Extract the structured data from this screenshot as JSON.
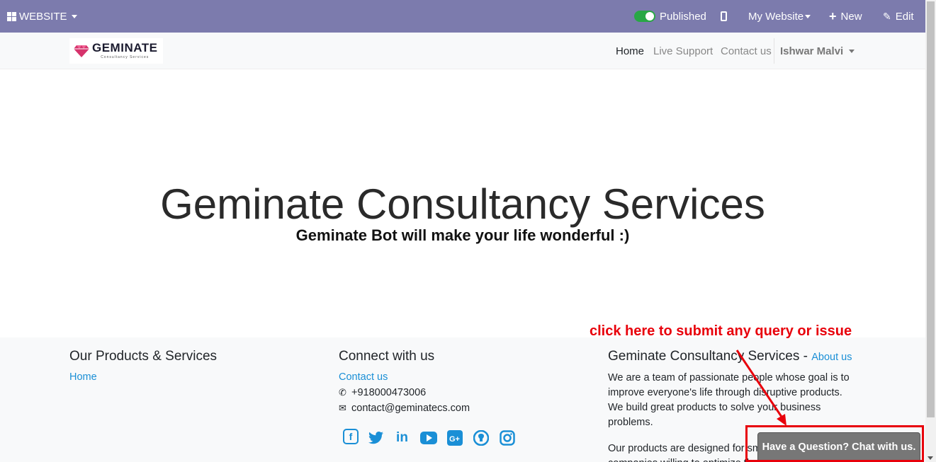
{
  "adminbar": {
    "website_label": "WEBSITE",
    "published_label": "Published",
    "my_website_label": "My Website",
    "new_label": "New",
    "edit_label": "Edit",
    "bg_color": "#7c7bad"
  },
  "navbar": {
    "logo_text": "GEMINATE",
    "logo_sub": "Consultancy Services",
    "links": [
      "Home",
      "Live Support",
      "Contact us"
    ],
    "user": "Ishwar Malvi"
  },
  "hero": {
    "title": "Geminate Consultancy Services",
    "subtitle": "Geminate Bot will make your life wonderful :)"
  },
  "footer": {
    "col1": {
      "title": "Our Products & Services",
      "link": "Home"
    },
    "col2": {
      "title": "Connect with us",
      "contact_link": "Contact us",
      "phone": "+918000473006",
      "email": "contact@geminatecs.com",
      "social": [
        "facebook-icon",
        "twitter-icon",
        "linkedin-icon",
        "youtube-icon",
        "google-plus-icon",
        "github-icon",
        "instagram-icon"
      ]
    },
    "col3": {
      "title": "Geminate Consultancy Services",
      "separator": " - ",
      "about_link": "About us",
      "p1": "We are a team of passionate people whose goal is to improve everyone's life through disruptive products. We build great products to solve your business problems.",
      "p2": "Our products are designed for small to medium size companies willing to optimize their performance."
    }
  },
  "annotation": {
    "text": "click here to submit any query or issue",
    "color": "#e8000b"
  },
  "chat_button": {
    "label": "Have a Question? Chat with us."
  }
}
